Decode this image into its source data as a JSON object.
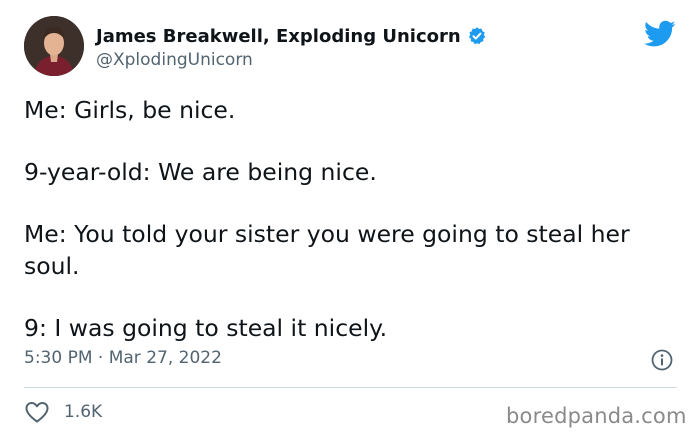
{
  "author": {
    "name": "James Breakwell, Exploding Unicorn",
    "handle": "@XplodingUnicorn",
    "verified": true,
    "avatar_icon": "profile-photo"
  },
  "tweet": {
    "lines": [
      "Me: Girls, be nice.",
      "9-year-old: We are being nice.",
      "Me: You told your sister you were going to steal her soul.",
      "9: I was going to steal it nicely."
    ],
    "timestamp": "5:30 PM · Mar 27, 2022"
  },
  "actions": {
    "likes": "1.6K",
    "like_icon": "heart-outline-icon",
    "info_icon": "info-icon"
  },
  "brand": {
    "platform_icon": "twitter-bird-icon",
    "platform_color": "#1d9bf0",
    "watermark": "boredpanda.com"
  }
}
